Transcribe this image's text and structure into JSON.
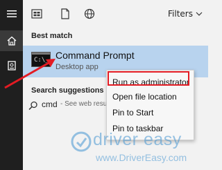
{
  "topbar": {
    "filters_label": "Filters",
    "icons": [
      "apps-icon",
      "document-icon",
      "globe-icon",
      "chevron-down-icon"
    ]
  },
  "rail": {
    "icons": [
      "hamburger-menu-icon",
      "home-icon",
      "document-box-icon"
    ]
  },
  "sections": {
    "best_match": "Best match",
    "search_suggestions": "Search suggestions"
  },
  "best_result": {
    "title": "Command Prompt",
    "subtitle": "Desktop app",
    "icon": "command-prompt-icon"
  },
  "suggestion": {
    "query": "cmd",
    "hint": "- See web resu"
  },
  "context_menu": {
    "items": [
      "Run as administrator",
      "Open file location",
      "Pin to Start",
      "Pin to taskbar"
    ],
    "highlighted_index": 0
  },
  "watermark": {
    "brand": "driver easy",
    "url": "www.DriverEasy.com"
  },
  "colors": {
    "accent_red": "#e31b23",
    "selection_blue": "#b8d3ee",
    "rail_bg": "#1f1f1f"
  }
}
